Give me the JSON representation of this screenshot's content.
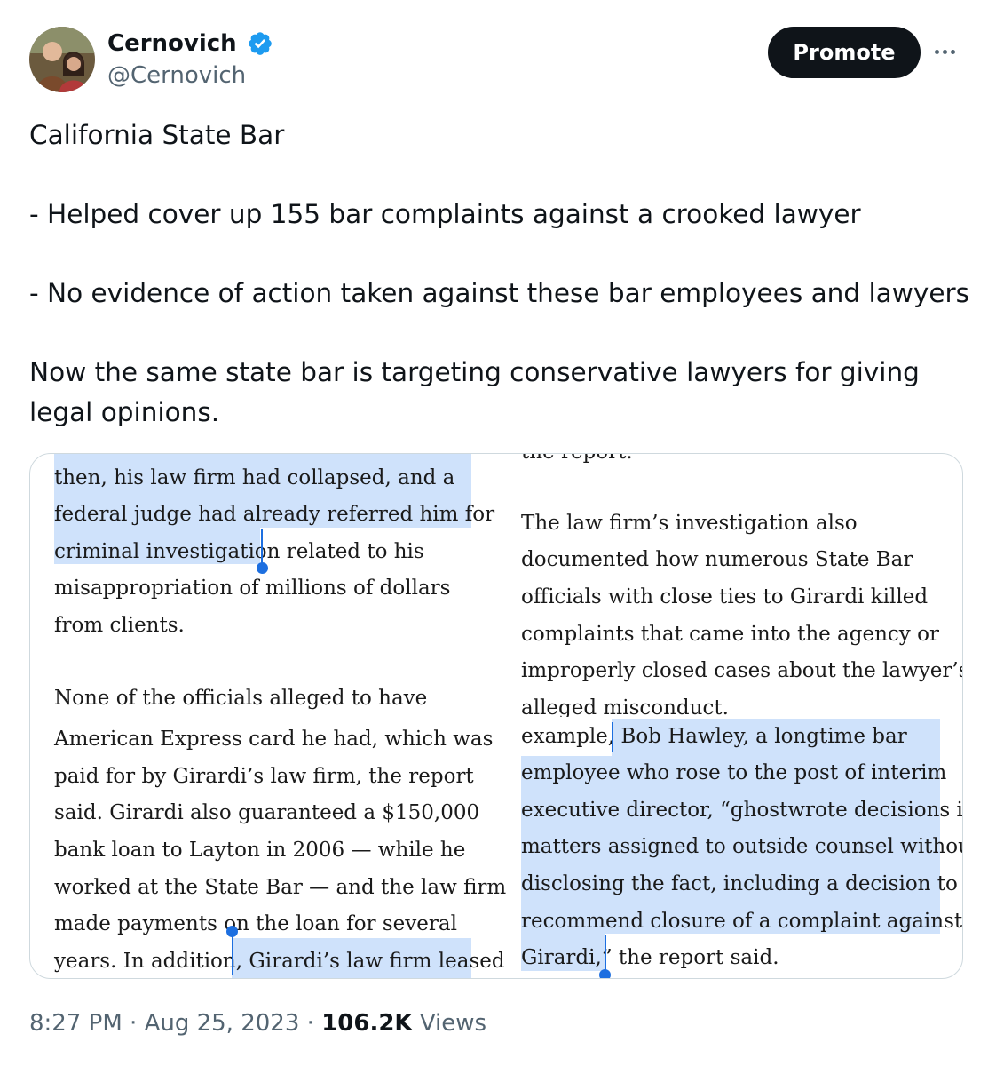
{
  "author": {
    "display_name": "Cernovich",
    "handle": "@Cernovich",
    "verified": true,
    "verified_icon": "verified-badge-icon"
  },
  "actions": {
    "promote_label": "Promote",
    "more_icon": "more-options-icon"
  },
  "tweet": {
    "paragraphs": [
      "California State Bar",
      "- Helped cover up 155 bar complaints against a crooked lawyer",
      "- No evidence of action taken against these bar employees and lawyers",
      "Now the same state bar is targeting conservative lawyers for giving legal opinions."
    ]
  },
  "media": {
    "left_lines": [
      "then, his law firm had collapsed, and a",
      "federal judge had already referred him for",
      "criminal investigation related to his",
      "misappropriation of millions of dollars",
      "from clients.",
      "None of the officials alleged to have",
      "American Express card he had, which was",
      "paid for by Girardi’s law firm, the report",
      "said. Girardi also guaranteed a $150,000",
      "bank loan to Layton in 2006 — while he",
      "worked at the State Bar — and the law firm",
      "made payments on the loan for several",
      "years. In addition, Girardi’s law firm leased"
    ],
    "right_lines": [
      "the report.",
      "The law firm’s investigation also",
      "documented how numerous State Bar",
      "officials with close ties to Girardi killed",
      "complaints that came into the agency or",
      "improperly closed cases about the lawyer’s",
      "alleged misconduct.",
      "example, Bob Hawley, a longtime bar",
      "employee who rose to the post of interim",
      "executive director, “ghostwrote decisions in",
      "matters assigned to outside counsel without",
      "disclosing the fact, including a decision to",
      "recommend closure of a complaint against",
      "Girardi,” the report said."
    ],
    "highlight_color": "#cfe2fb",
    "caret_color": "#1d6fe0"
  },
  "meta": {
    "time": "8:27 PM",
    "date": "Aug 25, 2023",
    "views_count": "106.2K",
    "views_label": "Views",
    "separator": " · "
  }
}
